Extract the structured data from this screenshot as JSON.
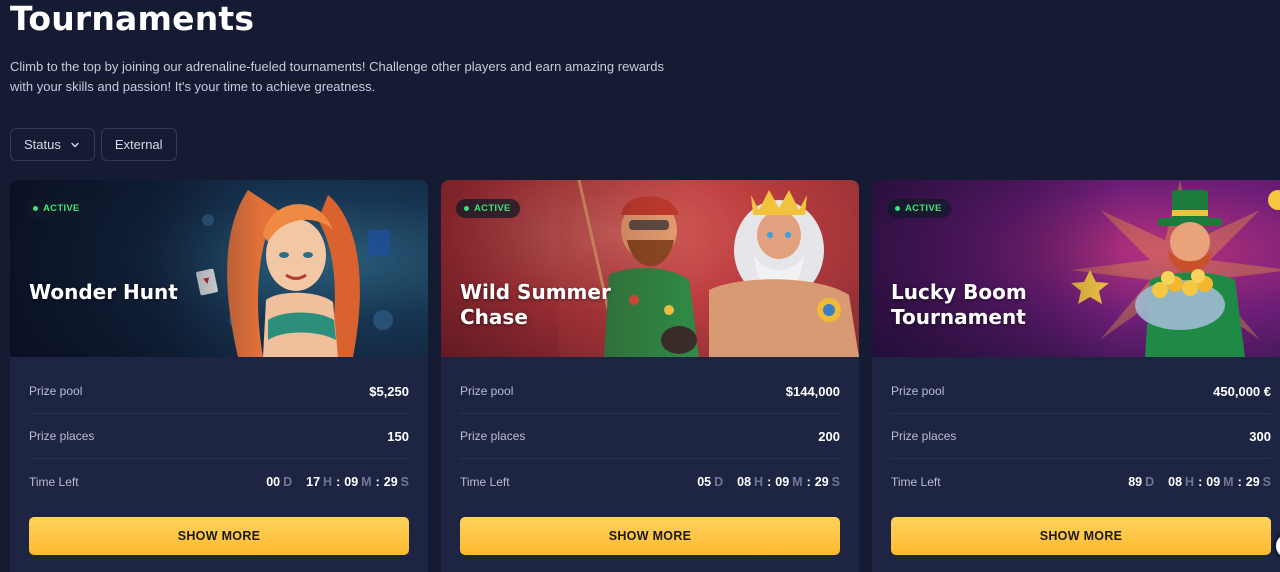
{
  "page": {
    "title": "Tournaments",
    "intro": "Climb to the top by joining our adrenaline-fueled tournaments! Challenge other players and earn amazing rewards with your skills and passion! It's your time to achieve greatness."
  },
  "filters": {
    "status_label": "Status",
    "external_label": "External"
  },
  "labels": {
    "prize_pool": "Prize pool",
    "prize_places": "Prize places",
    "time_left": "Time Left",
    "show_more": "SHOW MORE",
    "unit_d": "D",
    "unit_h": "H",
    "unit_m": "M",
    "unit_s": "S"
  },
  "cards": [
    {
      "status": "ACTIVE",
      "title": "Wonder Hunt",
      "prize_pool": "$5,250",
      "prize_places": "150",
      "time": {
        "d": "00",
        "h": "17",
        "m": "09",
        "s": "29"
      }
    },
    {
      "status": "ACTIVE",
      "title": "Wild Summer Chase",
      "prize_pool": "$144,000",
      "prize_places": "200",
      "time": {
        "d": "05",
        "h": "08",
        "m": "09",
        "s": "29"
      }
    },
    {
      "status": "ACTIVE",
      "title": "Lucky Boom Tournament",
      "prize_pool": "450,000 €",
      "prize_places": "300",
      "time": {
        "d": "89",
        "h": "08",
        "m": "09",
        "s": "29"
      }
    }
  ],
  "colors": {
    "background": "#151b33",
    "card": "#1e2543",
    "active": "#3ee27a",
    "button": "#fdb92f"
  }
}
